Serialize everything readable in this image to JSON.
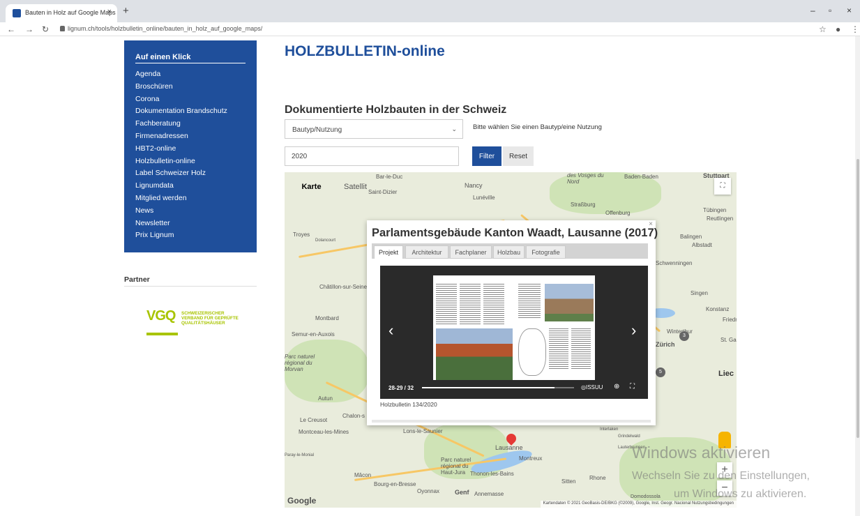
{
  "browser": {
    "tab_title": "Bauten in Holz auf Google Maps",
    "tab_close": "×",
    "new_tab": "+",
    "url": "lignum.ch/tools/holzbulletin_online/bauten_in_holz_auf_google_maps/",
    "window_controls": [
      "–",
      "▫",
      "×"
    ]
  },
  "sidebar": {
    "heading": "Auf einen Klick",
    "items": [
      "Agenda",
      "Broschüren",
      "Corona",
      "Dokumentation Brandschutz",
      "Fachberatung",
      "Firmenadressen",
      "HBT2-online",
      "Holzbulletin-online",
      "Label Schweizer Holz",
      "Lignumdata",
      "Mitglied werden",
      "News",
      "Newsletter",
      "Prix Lignum"
    ]
  },
  "partner": {
    "heading": "Partner",
    "logo_letters": "VGQ",
    "logo_text": "SCHWEIZERISCHER VERBAND FÜR GEPRÜFTE QUALITÄTSHÄUSER"
  },
  "main": {
    "title": "HOLZBULLETIN-online",
    "section_title": "Dokumentierte Holzbauten in der Schweiz",
    "select_value": "Bautyp/Nutzung",
    "select_hint": "Bitte wählen Sie einen Bautyp/eine Nutzung",
    "year_value": "2020",
    "filter_label": "Filter",
    "reset_label": "Reset"
  },
  "map": {
    "type_map": "Karte",
    "type_satellite": "Satellit",
    "logo": "Google",
    "attribution": "Kartendaten © 2021 GeoBasis-DE/BKG (©2009), Google, Inst. Geogr. Nacional   Nutzungsbedingungen",
    "labels": [
      "Bar-le-Duc",
      "Nancy",
      "Lunéville",
      "Straßburg",
      "Offenburg",
      "Baden-Baden",
      "Stuttgart",
      "Tübingen",
      "Reutlingen",
      "Balingen",
      "Albstadt",
      "Troyes",
      "Dolancourt",
      "Châtillon-sur-Seine",
      "Montbard",
      "Semur-en-Auxois",
      "Parc naturel régional du Morvan",
      "Autun",
      "Le Creusot",
      "Chalon-s",
      "Montceau-les-Mines",
      "Lons-le-Saunier",
      "Paray-le-Monial",
      "Mâcon",
      "Bourg-en-Bresse",
      "Oyonnax",
      "Genf",
      "Annemasse",
      "Thonon-les-Bains",
      "Lausanne",
      "Montreux",
      "Sitten",
      "Zürich",
      "Konstanz",
      "Singen",
      "Winterthur",
      "St. Ga",
      "Liec",
      "Friedr",
      "Schwenningen",
      "Saint-Dizier",
      "des Vosges du Nord",
      "Parc naturel régional du Haut-Jura",
      "Lauterbrunnen",
      "Interlaken",
      "Grindelwald",
      "Rhone",
      "Domodossola"
    ],
    "clusters": [
      "3",
      "5"
    ]
  },
  "infowindow": {
    "title": "Parlamentsgebäude Kanton Waadt, Lausanne (2017)",
    "close": "×",
    "tabs": [
      "Projekt",
      "Architektur",
      "Fachplaner",
      "Holzbau",
      "Fotografie"
    ],
    "page_count": "28-29 / 32",
    "viewer_brand": "◎ISSUU",
    "progress": 0.87,
    "caption": "Holzbulletin 134/2020"
  },
  "watermark": {
    "line1": "Windows aktivieren",
    "line2": "Wechseln Sie zu den Einstellungen,",
    "line3": "um Windows zu aktivieren."
  },
  "colors": {
    "brand_blue": "#1f4f9b",
    "vgq_green": "#a8c400",
    "map_bg": "#e9ecdc"
  }
}
